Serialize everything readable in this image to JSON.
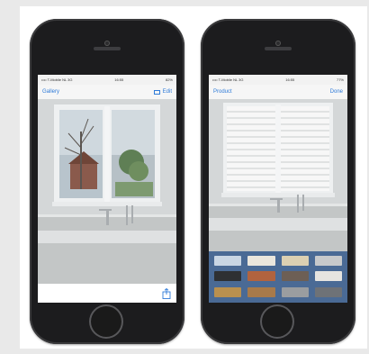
{
  "left_phone": {
    "status": {
      "carrier": "•••• T-Mobile NL 3G",
      "time": "16:55",
      "battery": "82%"
    },
    "nav": {
      "back_label": "Gallery",
      "edit_label": "Edit"
    }
  },
  "right_phone": {
    "status": {
      "carrier": "•••• T-Mobile NL 3G",
      "time": "16:55",
      "battery": "77%"
    },
    "nav": {
      "back_label": "Product",
      "done_label": "Done"
    },
    "palette": {
      "swatches": [
        "#c9d6e4",
        "#eae6dd",
        "#dcd0b2",
        "#c7c9cb",
        "#2e3033",
        "#b1633f",
        "#6d5f55",
        "#e6e4e0",
        "#b9904f",
        "#a87a4a",
        "#9a9da0",
        "#6e7277"
      ]
    }
  },
  "colors": {
    "accent_blue": "#2f7bd8",
    "palette_bg": "#4a6a95",
    "phone_body": "#1c1c1e"
  }
}
